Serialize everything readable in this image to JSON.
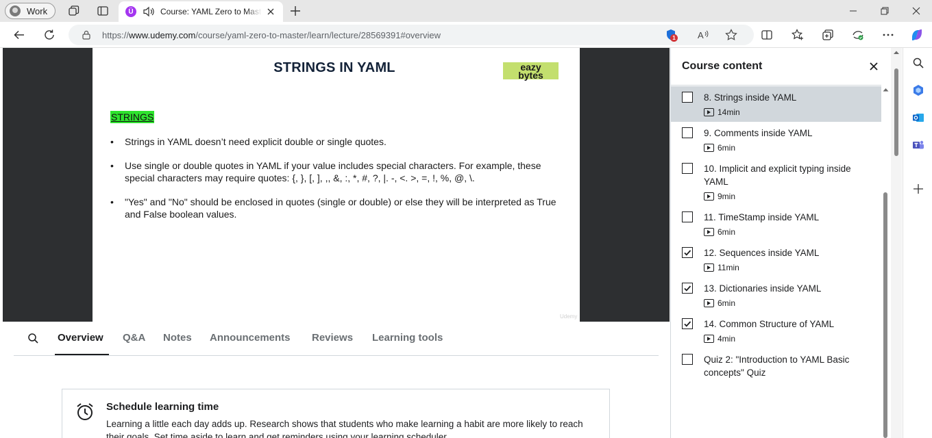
{
  "browser": {
    "profile_name": "Work",
    "tab_title": "Course: YAML Zero to Master | Udemy",
    "url_prefix": "https://",
    "url_domain": "www.udemy.com",
    "url_path": "/course/yaml-zero-to-master/learn/lecture/28569391#overview",
    "extension_badge": "1"
  },
  "slide": {
    "title": "STRINGS IN YAML",
    "brand_line1": "eazy",
    "brand_line2": "bytes",
    "heading": "STRINGS",
    "bullets": [
      "Strings in YAML doesn’t need explicit double or single quotes.",
      "Use single or double quotes in YAML if your value includes special characters. For example, these special characters may require quotes: {, }, [, ], ,, &, :, *, #, ?, |. -, <. >, =, !, %, @, \\.",
      "\"Yes\" and \"No\" should be enclosed in quotes (single or double) or else they will be interpreted as True and False boolean values."
    ],
    "watermark": "Udemy"
  },
  "tabs": [
    "Overview",
    "Q&A",
    "Notes",
    "Announcements",
    "Reviews",
    "Learning tools"
  ],
  "schedule": {
    "title": "Schedule learning time",
    "text": "Learning a little each day adds up. Research shows that students who make learning a habit are more likely to reach their goals. Set time aside to learn and get reminders using your learning scheduler."
  },
  "course_content": {
    "title": "Course content",
    "lessons": [
      {
        "title": "8. Strings inside YAML",
        "duration": "14min",
        "checked": false,
        "current": true
      },
      {
        "title": "9. Comments inside YAML",
        "duration": "6min",
        "checked": false,
        "current": false
      },
      {
        "title": "10. Implicit and explicit typing inside YAML",
        "duration": "9min",
        "checked": false,
        "current": false
      },
      {
        "title": "11. TimeStamp inside YAML",
        "duration": "6min",
        "checked": false,
        "current": false
      },
      {
        "title": "12. Sequences inside YAML",
        "duration": "11min",
        "checked": true,
        "current": false
      },
      {
        "title": "13. Dictionaries inside YAML",
        "duration": "6min",
        "checked": true,
        "current": false
      },
      {
        "title": "14. Common Structure of YAML",
        "duration": "4min",
        "checked": true,
        "current": false
      },
      {
        "title": "Quiz 2: \"Introduction to YAML Basic concepts\" Quiz",
        "duration": "",
        "checked": false,
        "current": false
      }
    ]
  },
  "colors": {
    "udemy_purple": "#a435f0",
    "highlight_green": "#2ee32e",
    "brand_lime": "#c3df6e",
    "current_lesson_bg": "#d1d7dc"
  }
}
